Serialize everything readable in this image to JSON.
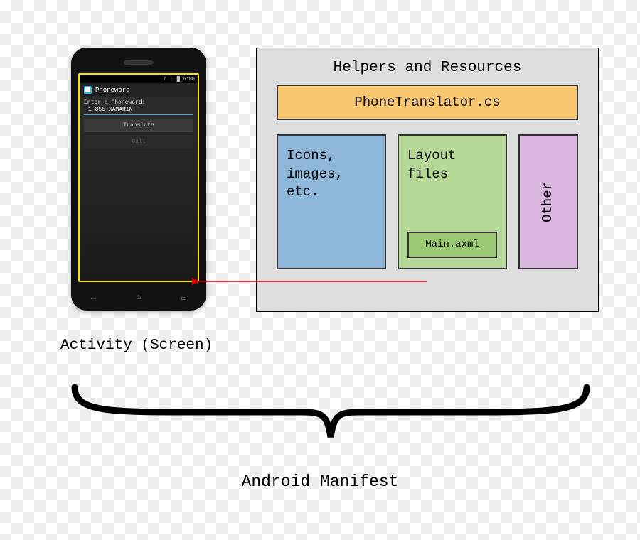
{
  "phone": {
    "status": {
      "left": "",
      "right": "7 ⋮ █ 6:00"
    },
    "app_name": "Phoneword",
    "prompt": "Enter a Phoneword:",
    "field_value": "1-855-XAMARIN",
    "btn_translate": "Translate",
    "btn_call": "Call"
  },
  "panel": {
    "title": "Helpers and Resources",
    "file": "PhoneTranslator.cs",
    "icons": "Icons,\nimages,\netc.",
    "layout": "Layout\nfiles",
    "layout_sub": "Main.axml",
    "other": "Other"
  },
  "captions": {
    "activity": "Activity (Screen)",
    "manifest": "Android Manifest"
  }
}
